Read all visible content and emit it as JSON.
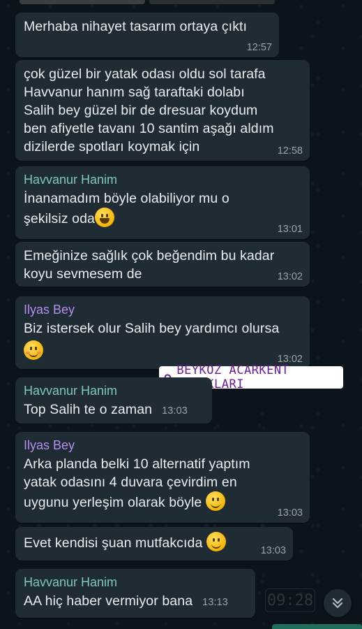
{
  "messages": [
    {
      "text": "Merhaba nihayet tasarım ortaya çıktı",
      "time": "12:57"
    },
    {
      "text": "çok güzel bir yatak odası oldu sol tarafa\nHavvanur hanım sağ taraftaki dolabı\nSalih bey güzel bir de dresuar koydum\nben afiyetle tavanı 10 santim aşağı aldım\ndizilerde spotları koymak için",
      "time": "12:58"
    },
    {
      "sender": "Havvanur Hanim",
      "text": "İnanamadım böyle olabiliyor mu o\nşekilsiz oda",
      "time": "13:01"
    },
    {
      "text": "Emeğinize sağlık çok beğendim bu kadar\nkoyu sevmesem de",
      "time": "13:02"
    },
    {
      "sender": "Ilyas Bey",
      "text": "Biz istersek olur Salih bey yardımcı olursa",
      "time": "13:02"
    },
    {
      "sender": "Havvanur Hanim",
      "text": "Top Salih te o zaman",
      "time": "13:03"
    },
    {
      "sender": "Ilyas Bey",
      "text": "Arka planda belki 10 alternatif yaptım\nyatak odasını 4 duvara çevirdim en\nuygunu yerleşim olarak böyle",
      "time": "13:03"
    },
    {
      "text": "Evet kendisi şuan mutfakcıda",
      "time": "13:03"
    },
    {
      "sender": "Havvanur Hanim",
      "text": "AA hiç haber vermiyor bana",
      "time": "13:13"
    }
  ],
  "location_tag": "BEYKOZ ACARKENT KONAKLARI",
  "clock_overlay": "09:28",
  "icons": {
    "scroll": "chevron-double-down-icon",
    "location": "map-pin-icon",
    "emoji_grin": "grinning-face-emoji",
    "emoji_blush": "hand-over-mouth-emoji",
    "emoji_smile": "smiling-face-emoji"
  },
  "colors": {
    "background": "#0b141a",
    "bubble": "#202c33",
    "sender_havvanur": "#7fc6bb",
    "sender_ilyas": "#b48ff0",
    "location_text": "#6a1b9a"
  }
}
